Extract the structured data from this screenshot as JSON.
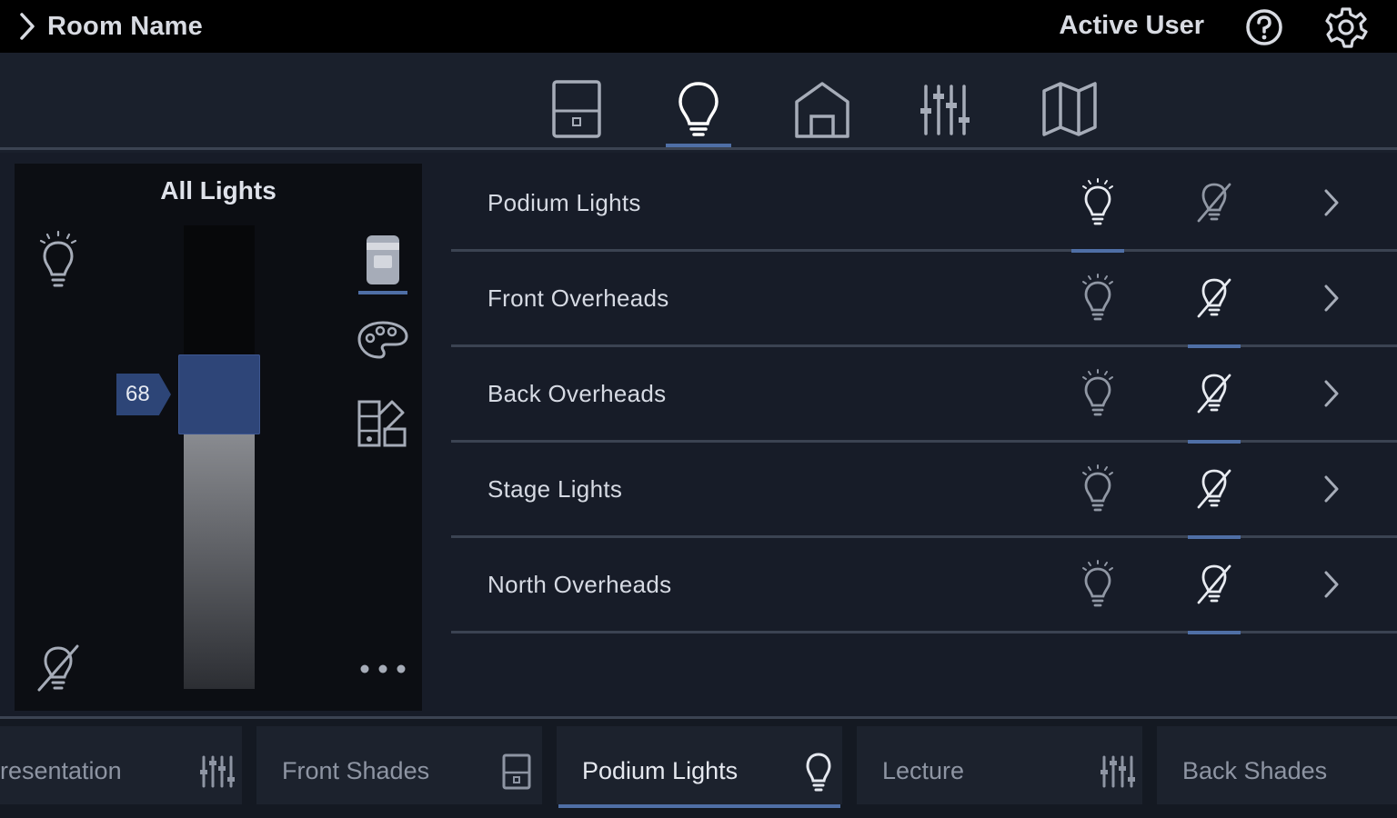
{
  "header": {
    "room_name": "Room Name",
    "user": "Active User"
  },
  "nav": {
    "tabs": [
      "shades-icon",
      "lightbulb-icon",
      "home-icon",
      "sliders-icon",
      "map-icon"
    ],
    "active": "lightbulb-icon"
  },
  "panel": {
    "title": "All Lights",
    "level_value": "68",
    "level": 68
  },
  "rows": [
    {
      "label": "Podium Lights",
      "state": "on"
    },
    {
      "label": "Front Overheads",
      "state": "off"
    },
    {
      "label": "Back Overheads",
      "state": "off"
    },
    {
      "label": "Stage Lights",
      "state": "off"
    },
    {
      "label": "North Overheads",
      "state": "off"
    }
  ],
  "dock": [
    {
      "label": "resentation",
      "icon": "sliders-icon"
    },
    {
      "label": "Front Shades",
      "icon": "shades-icon"
    },
    {
      "label": "Podium Lights",
      "icon": "lightbulb-icon",
      "active": true
    },
    {
      "label": "Lecture",
      "icon": "sliders-icon"
    },
    {
      "label": "Back Shades",
      "icon": "shades-icon"
    }
  ],
  "colors": {
    "accent": "#4f6fa6",
    "thumb": "#2e4578",
    "background": "#171c28"
  }
}
